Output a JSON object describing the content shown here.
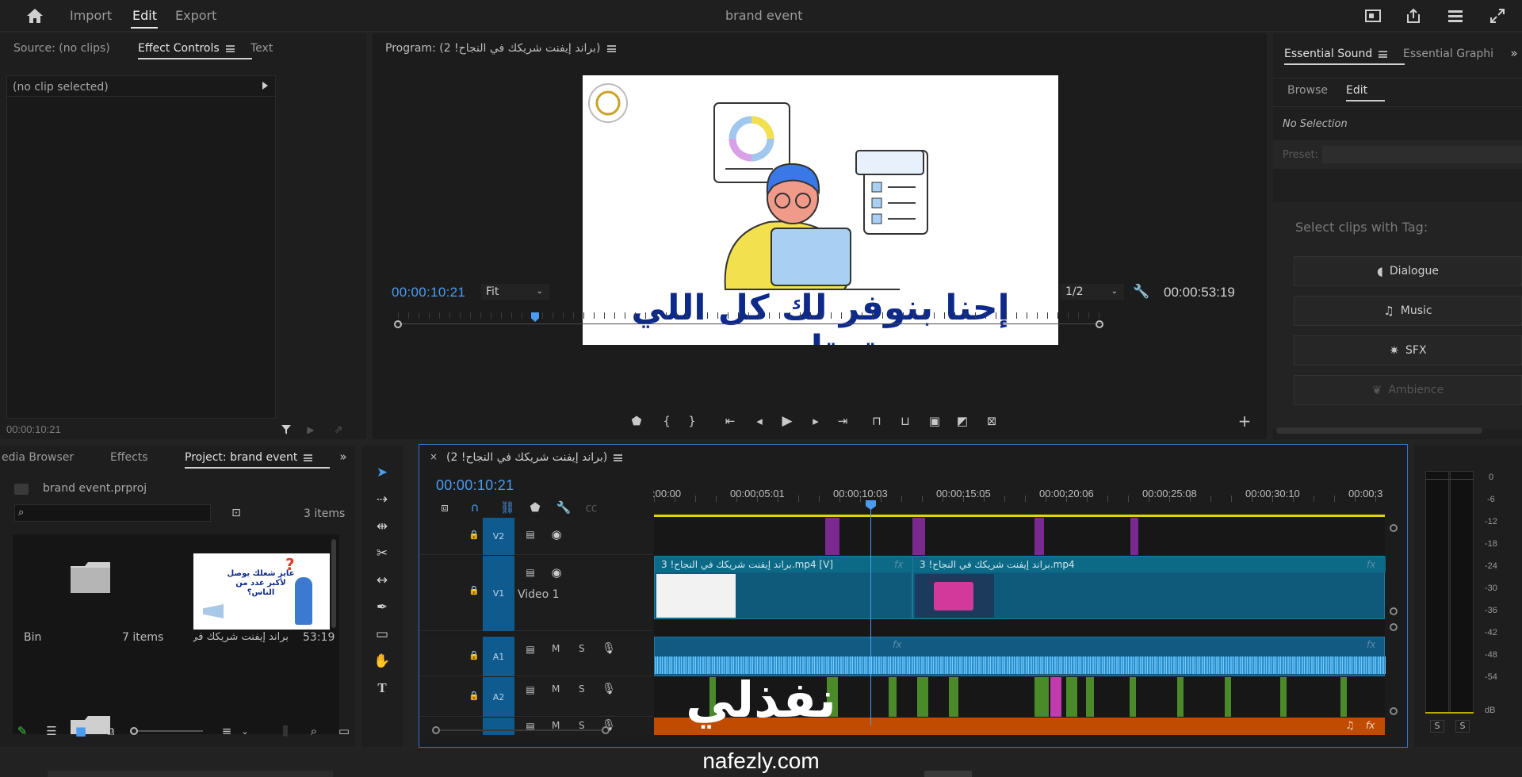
{
  "topbar": {
    "menu": {
      "import": "Import",
      "edit": "Edit",
      "export": "Export"
    },
    "project_title": "brand event"
  },
  "source_panel": {
    "tab_source": "Source: (no clips)",
    "tab_effect_controls": "Effect Controls",
    "tab_text": "Text",
    "no_clip": "(no clip selected)",
    "timecode": "00:00:10:21"
  },
  "program_monitor": {
    "title": "Program: (2 !براند إيفنت شريكك في النجاح)",
    "frame_caption": "إحنا بنوفر لك كل اللي تحتاجه",
    "timecode_current": "00:00:10:21",
    "zoom": "Fit",
    "resolution": "1/2",
    "timecode_duration": "00:00:53:19"
  },
  "essential_sound": {
    "tab_essential_sound": "Essential Sound",
    "tab_essential_graphics": "Essential Graphi",
    "sub_browse": "Browse",
    "sub_edit": "Edit",
    "no_selection": "No Selection",
    "preset_label": "Preset:",
    "select_tag_label": "Select clips with Tag:",
    "buttons": {
      "dialogue": "Dialogue",
      "music": "Music",
      "sfx": "SFX",
      "ambience": "Ambience"
    }
  },
  "project_panel": {
    "tab_media_browser": "edia Browser",
    "tab_effects": "Effects",
    "tab_project": "Project: brand event",
    "project_file": "brand event.prproj",
    "items_count": "3 items",
    "bin": {
      "name": "Bin",
      "count": "7 items"
    },
    "clip": {
      "name": "براند إيفنت شريكك في...",
      "duration": "53:19",
      "thumb_text": "عايز شغلك يوصل لأكبر عدد من الناس؟"
    }
  },
  "timeline": {
    "sequence_tab": "(2 !براند إيفنت شريكك في النجاح)",
    "timecode": "00:00:10:21",
    "ruler_labels": [
      ":00:00",
      "00:00:05:01",
      "00:00:10:03",
      "00:00:15:05",
      "00:00:20:06",
      "00:00:25:08",
      "00:00:30:10",
      "00:00:3"
    ],
    "tracks": {
      "v2": "V2",
      "v1": "V1",
      "v1_name": "Video 1",
      "a1": "A1",
      "a2": "A2"
    },
    "clips": {
      "v1_clip1": "براند إيفنت شريكك في النجاح! 3.mp4 [V]",
      "v1_clip2": "براند إيفنت شريكك في النجاح! 3.mp4"
    },
    "fx_label": "fx",
    "track_toggles": {
      "mute": "M",
      "solo": "S"
    }
  },
  "audio_meter": {
    "scale": [
      "0",
      "-6",
      "-12",
      "-18",
      "-24",
      "-30",
      "-36",
      "-42",
      "-48",
      "-54",
      "dB"
    ],
    "solo_left": "S",
    "solo_right": "S"
  },
  "watermark": {
    "arabic": "نفذلي",
    "latin": "nafezly.com"
  },
  "colors": {
    "accent_blue": "#4a9cf0",
    "video_clip": "#0f5a7a",
    "audio_clip": "#125a82",
    "music_track": "#c14b00",
    "playhead": "#4a9cf0",
    "work_area": "#e1d400"
  }
}
